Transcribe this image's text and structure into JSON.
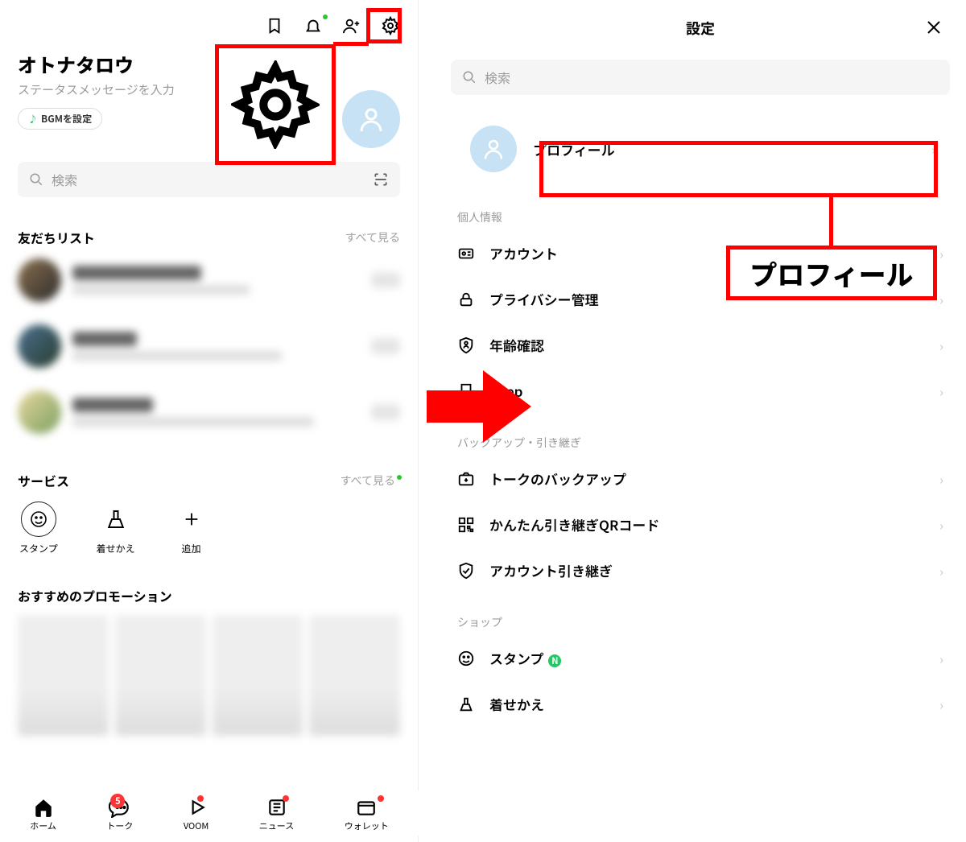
{
  "left": {
    "profile_name": "オトナタロウ",
    "profile_status": "ステータスメッセージを入力",
    "bgm_label": "BGMを設定",
    "search_placeholder": "検索",
    "friends_title": "友だちリスト",
    "see_all": "すべて見る",
    "services_title": "サービス",
    "services": [
      {
        "label": "スタンプ"
      },
      {
        "label": "着せかえ"
      },
      {
        "label": "追加"
      }
    ],
    "promo_title": "おすすめのプロモーション",
    "tabs": [
      {
        "label": "ホーム"
      },
      {
        "label": "トーク",
        "count": "5"
      },
      {
        "label": "VOOM"
      },
      {
        "label": "ニュース"
      },
      {
        "label": "ウォレット"
      }
    ]
  },
  "right": {
    "title": "設定",
    "search_placeholder": "検索",
    "profile_label": "プロフィール",
    "group_personal": "個人情報",
    "items_personal": [
      "アカウント",
      "プライバシー管理",
      "年齢確認",
      "Keep"
    ],
    "group_backup": "バックアップ・引き継ぎ",
    "items_backup": [
      "トークのバックアップ",
      "かんたん引き継ぎQRコード",
      "アカウント引き継ぎ"
    ],
    "group_shop": "ショップ",
    "items_shop": [
      "スタンプ",
      "着せかえ"
    ]
  },
  "annotations": {
    "profile_callout": "プロフィール"
  }
}
